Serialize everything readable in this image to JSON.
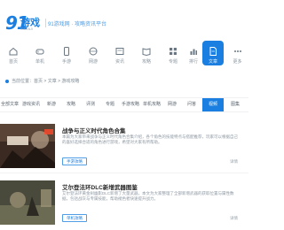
{
  "header": {
    "logo_number": "91",
    "logo_name": "游戏",
    "logo_sub": "91DANJI",
    "slogan": "91游戏网 · 攻略资讯平台"
  },
  "nav": {
    "items": [
      {
        "label": "首页",
        "icon": "home-icon"
      },
      {
        "label": "单机",
        "icon": "gamepad-icon"
      },
      {
        "label": "手游",
        "icon": "phone-icon"
      },
      {
        "label": "网游",
        "icon": "globe-icon"
      },
      {
        "label": "资讯",
        "icon": "news-icon"
      },
      {
        "label": "攻略",
        "icon": "book-icon"
      },
      {
        "label": "专题",
        "icon": "grid-icon"
      },
      {
        "label": "排行",
        "icon": "chart-icon"
      },
      {
        "label": "文章",
        "icon": "document-icon",
        "active": true
      },
      {
        "label": "更多",
        "icon": "more-icon"
      }
    ]
  },
  "crumb": "当前位置：首页 > 文章 > 游戏攻略",
  "tabs": [
    {
      "label": "全部文章"
    },
    {
      "label": "游戏资讯"
    },
    {
      "label": "新游"
    },
    {
      "label": "攻略"
    },
    {
      "label": "评测"
    },
    {
      "label": "专题"
    },
    {
      "label": "手游攻略"
    },
    {
      "label": "单机攻略"
    },
    {
      "label": "网游"
    },
    {
      "label": "问答"
    },
    {
      "label": "视频",
      "active": true
    },
    {
      "label": "图集"
    }
  ],
  "articles": [
    {
      "title": "战争与正义时代角色合集",
      "desc": "本篇为大家带来战争与正义时代角色合集介绍，各个角色的技能特点与搭配推荐，玩家可以根据自己的喜好选择合适的角色进行游戏，希望对大家有所帮助。",
      "tag": "手游攻略",
      "more": "详情"
    },
    {
      "title": "艾尔登法环DLC新增武器图鉴",
      "desc": "艾尔登法环黄金树幽影DLC新增了大量武器，本文为大家整理了全部新增武器的获取位置与属性数据，包括战灰与专属技能，帮助褪色者快速提升战力。",
      "tag": "单机攻略",
      "more": "详情"
    }
  ],
  "colors": {
    "accent": "#1a7fe0",
    "nav_text": "#8a96a0"
  }
}
